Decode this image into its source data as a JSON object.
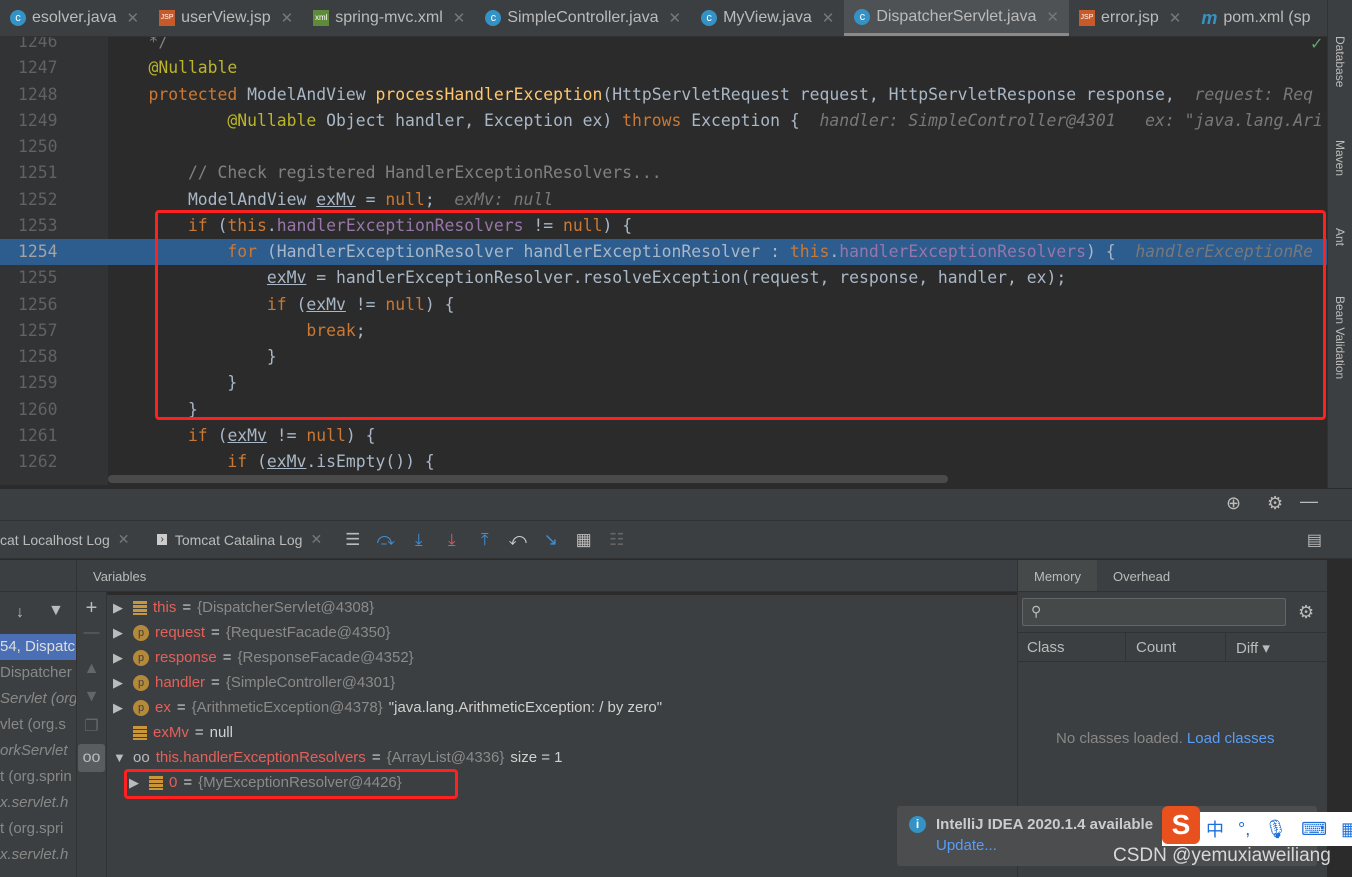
{
  "tabs": [
    {
      "label": "esolver.java",
      "icon": "class-icon",
      "type": "c"
    },
    {
      "label": "userView.jsp",
      "icon": "jsp-icon",
      "type": "jsp"
    },
    {
      "label": "spring-mvc.xml",
      "icon": "xml-icon",
      "type": "xml"
    },
    {
      "label": "SimpleController.java",
      "icon": "class-icon",
      "type": "c"
    },
    {
      "label": "MyView.java",
      "icon": "class-icon",
      "type": "c"
    },
    {
      "label": "DispatcherServlet.java",
      "icon": "class-icon",
      "type": "c",
      "active": true
    },
    {
      "label": "error.jsp",
      "icon": "jsp-icon",
      "type": "jsp"
    },
    {
      "label": "pom.xml (sp",
      "icon": "maven-icon",
      "type": "m"
    }
  ],
  "right_tools": [
    "Database",
    "Maven",
    "Ant",
    "Bean Validation"
  ],
  "code": [
    {
      "n": "1246",
      "t": [
        [
          "    */",
          "cm"
        ]
      ]
    },
    {
      "n": "1247",
      "t": [
        [
          "    @Nullable",
          "ann"
        ]
      ]
    },
    {
      "n": "1248",
      "t": [
        [
          "    protected ",
          "kw"
        ],
        [
          "ModelAndView ",
          ""
        ],
        [
          "processHandlerException",
          "fn"
        ],
        [
          "(HttpServletRequest request, HttpServletResponse response,  ",
          ""
        ],
        [
          "request: Req",
          "hint"
        ]
      ]
    },
    {
      "n": "1249",
      "t": [
        [
          "            @Nullable ",
          "ann"
        ],
        [
          "Object handler, Exception ex) ",
          ""
        ],
        [
          "throws ",
          "kw"
        ],
        [
          "Exception {  ",
          ""
        ],
        [
          "handler: SimpleController@4301   ex: \"java.lang.Ari",
          "hint"
        ]
      ]
    },
    {
      "n": "1250",
      "t": []
    },
    {
      "n": "1251",
      "t": [
        [
          "        // Check registered HandlerExceptionResolvers...",
          "cm"
        ]
      ]
    },
    {
      "n": "1252",
      "t": [
        [
          "        ModelAndView ",
          ""
        ],
        [
          "exMv",
          "ul"
        ],
        [
          " = ",
          ""
        ],
        [
          "null",
          "kw"
        ],
        [
          ";  ",
          ""
        ],
        [
          "exMv: null",
          "hint"
        ]
      ]
    },
    {
      "n": "1253",
      "t": [
        [
          "        if ",
          "kw"
        ],
        [
          "(",
          ""
        ],
        [
          "this",
          "kw"
        ],
        [
          ".",
          ""
        ],
        [
          "handlerExceptionResolvers",
          "fld"
        ],
        [
          " != ",
          ""
        ],
        [
          "null",
          "kw"
        ],
        [
          ") {",
          ""
        ]
      ]
    },
    {
      "n": "1254",
      "cur": true,
      "t": [
        [
          "            for ",
          "kw"
        ],
        [
          "(HandlerExceptionResolver handlerExceptionResolver : ",
          ""
        ],
        [
          "this",
          "kw"
        ],
        [
          ".",
          ""
        ],
        [
          "handlerExceptionResolvers",
          "fld"
        ],
        [
          ") {  ",
          ""
        ],
        [
          "handlerExceptionRe",
          "hint"
        ]
      ]
    },
    {
      "n": "1255",
      "t": [
        [
          "                ",
          ""
        ],
        [
          "exMv",
          "ul"
        ],
        [
          " = handlerExceptionResolver.resolveException(request, response, handler, ex);",
          ""
        ]
      ]
    },
    {
      "n": "1256",
      "t": [
        [
          "                if ",
          "kw"
        ],
        [
          "(",
          ""
        ],
        [
          "exMv",
          "ul"
        ],
        [
          " != ",
          ""
        ],
        [
          "null",
          "kw"
        ],
        [
          ") {",
          ""
        ]
      ]
    },
    {
      "n": "1257",
      "t": [
        [
          "                    break",
          "kw"
        ],
        [
          ";",
          ""
        ]
      ]
    },
    {
      "n": "1258",
      "t": [
        [
          "                }",
          ""
        ]
      ]
    },
    {
      "n": "1259",
      "t": [
        [
          "            }",
          ""
        ]
      ]
    },
    {
      "n": "1260",
      "t": [
        [
          "        }",
          ""
        ]
      ]
    },
    {
      "n": "1261",
      "t": [
        [
          "        if ",
          "kw"
        ],
        [
          "(",
          ""
        ],
        [
          "exMv",
          "ul"
        ],
        [
          " != ",
          ""
        ],
        [
          "null",
          "kw"
        ],
        [
          ") {",
          ""
        ]
      ]
    },
    {
      "n": "1262",
      "t": [
        [
          "            if ",
          "kw"
        ],
        [
          "(",
          ""
        ],
        [
          "exMv",
          "ul"
        ],
        [
          ".isEmpty()) {",
          ""
        ]
      ]
    }
  ],
  "debug_tabs": [
    {
      "label": "cat Localhost Log"
    },
    {
      "label": "Tomcat Catalina Log"
    }
  ],
  "frames": [
    "54, Dispatc",
    "Dispatcher",
    "Servlet (org",
    "vlet (org.s",
    "orkServlet",
    "t (org.sprin",
    "x.servlet.h",
    "t (org.spri",
    "x.servlet.h"
  ],
  "variables_label": "Variables",
  "variables": [
    {
      "icon": "field",
      "name": "this",
      "value": "{DispatcherServlet@4308}",
      "expand": "▶"
    },
    {
      "icon": "param",
      "name": "request",
      "value": "{RequestFacade@4350}",
      "expand": "▶"
    },
    {
      "icon": "param",
      "name": "response",
      "value": "{ResponseFacade@4352}",
      "expand": "▶"
    },
    {
      "icon": "param",
      "name": "handler",
      "value": "{SimpleController@4301}",
      "expand": "▶"
    },
    {
      "icon": "param",
      "name": "ex",
      "value": "{ArithmeticException@4378}",
      "extra": "\"java.lang.ArithmeticException: / by zero\"",
      "expand": "▶"
    },
    {
      "icon": "field",
      "name": "exMv",
      "value": "",
      "extra": "null",
      "expand": ""
    },
    {
      "icon": "watch",
      "name": "this.handlerExceptionResolvers",
      "value": "{ArrayList@4336}",
      "extra": "size = 1",
      "expand": "▼"
    },
    {
      "icon": "field",
      "name": "0",
      "value": "{MyExceptionResolver@4426}",
      "expand": "▶",
      "child": true
    }
  ],
  "memory": {
    "tabs": [
      "Memory",
      "Overhead"
    ],
    "search_placeholder": "",
    "columns": [
      "Class",
      "Count",
      "Diff"
    ],
    "empty_text": "No classes loaded.",
    "load_link": "Load classes"
  },
  "notification": {
    "title": "IntelliJ IDEA 2020.1.4 available",
    "link": "Update..."
  },
  "watermark": "CSDN @yemuxiaweiliang",
  "ime": {
    "lang": "中",
    "punct": "°,"
  }
}
